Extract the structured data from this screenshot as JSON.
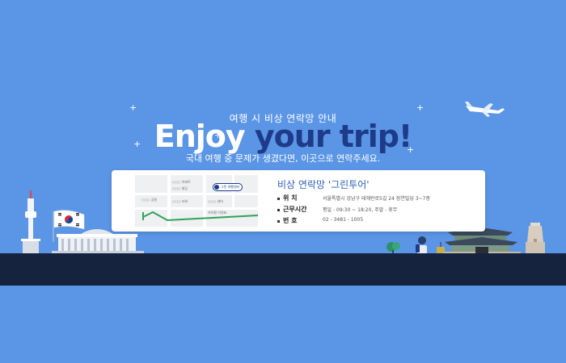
{
  "header": {
    "subtitle": "여행 시 비상 연락망 안내",
    "title_part1": "Enjoy ",
    "title_part2": "your trip!",
    "description": "국내 여행 중 문제가 생겼다면, 이곳으로 연락주세요."
  },
  "card": {
    "title": "비상 연락망 '그린투어'",
    "rows": [
      {
        "label": "위   치",
        "value": "서울특별시 강남구 테헤란로5길 24 장연빌딩 3~7층"
      },
      {
        "label": "근무시간",
        "value": "평일 - 09:30 ~ 18:20, 주말 - 휴무"
      },
      {
        "label": "번   호",
        "value": "02 - 3481 - 1005"
      }
    ]
  },
  "map": {
    "labels": [
      "지하철 이정표",
      "○○○ 아파트",
      "○○○ 빌딩",
      "○○○ 공원",
      "○○○ 타워",
      "○○○ 센터"
    ],
    "marker_label": "그린 여행센터"
  },
  "colors": {
    "background": "#5b95e6",
    "title_dark": "#1d3b88",
    "card_title": "#2b5fb8",
    "ground": "#15233f"
  },
  "icons": {
    "airplane": "airplane-icon",
    "flag": "korean-flag-icon",
    "tower": "seoul-tower-icon",
    "assembly": "national-assembly-icon",
    "gate": "palace-gate-icon",
    "pagoda": "stone-pagoda-icon",
    "traveler": "traveler-icon"
  }
}
